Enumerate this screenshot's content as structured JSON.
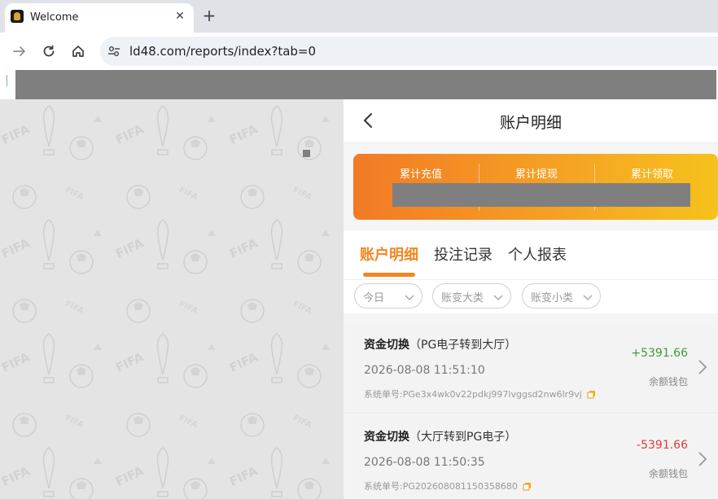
{
  "browser": {
    "tab_title": "Welcome",
    "tab_close": "✕",
    "new_tab": "+",
    "url": "ld48.com/reports/index?tab=0"
  },
  "panel": {
    "title": "账户明细",
    "summary": {
      "labels": [
        "累计充值",
        "累计提现",
        "累计领取"
      ]
    },
    "tabs": [
      {
        "label": "账户明细",
        "active": true
      },
      {
        "label": "投注记录",
        "active": false
      },
      {
        "label": "个人报表",
        "active": false
      }
    ],
    "filters": [
      "今日",
      "账变大类",
      "账变小类"
    ],
    "records": [
      {
        "type": "资金切换",
        "detail": "（PG电子转到大厅）",
        "time": "2026-08-08 11:51:10",
        "order_label": "系统单号:",
        "order_no": "PGe3x4wk0v22pdkj997lvggsd2nw6lr9vj",
        "amount": "+5391.66",
        "wallet": "余额钱包"
      },
      {
        "type": "资金切换",
        "detail": "（大厅转到PG电子）",
        "time": "2026-08-08 11:50:35",
        "order_label": "系统单号:",
        "order_no": "PG202608081150358680",
        "amount": "-5391.66",
        "wallet": "余额钱包"
      }
    ]
  },
  "colors": {
    "accent": "#f5851f",
    "positive": "#3a9d3a",
    "negative": "#e23a3a"
  }
}
